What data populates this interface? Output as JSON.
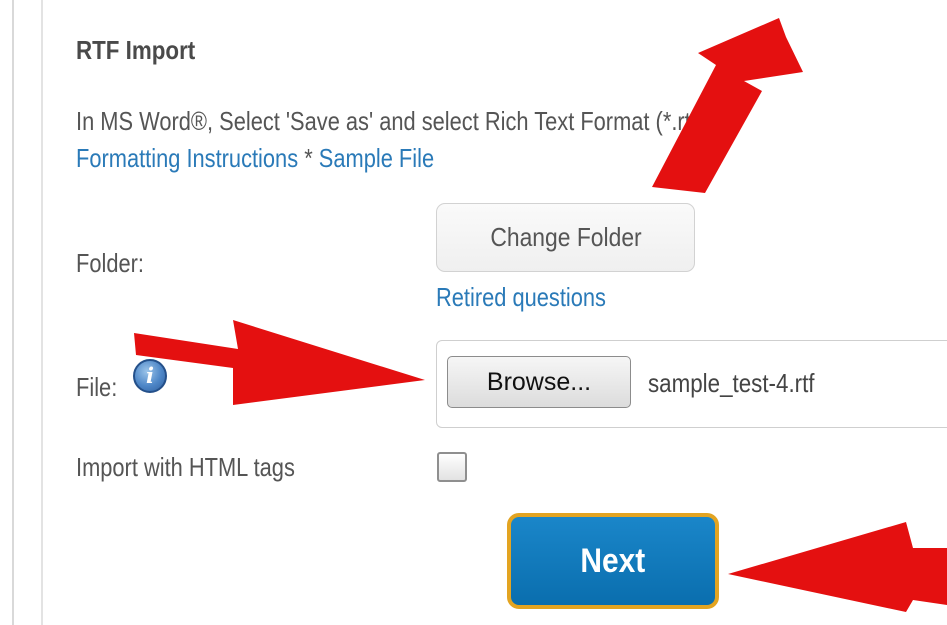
{
  "section": {
    "title": "RTF Import",
    "description": "In MS Word®, Select 'Save as' and select Rich Text Format (*.rtf).",
    "links": {
      "formatting": "Formatting Instructions",
      "separator": "*",
      "sample": "Sample File"
    }
  },
  "form": {
    "folder_label": "Folder:",
    "change_folder_button": "Change Folder",
    "retired_link": "Retired questions",
    "file_label": "File:",
    "info_icon": "info-icon",
    "browse_button": "Browse...",
    "selected_file": "sample_test-4.rtf",
    "html_tags_label": "Import with HTML tags",
    "html_tags_checked": false,
    "next_button": "Next"
  },
  "colors": {
    "link": "#2a7ab8",
    "next_bg": "#0f78bd",
    "next_border": "#e3a421",
    "annotation_arrow": "#e41010"
  }
}
